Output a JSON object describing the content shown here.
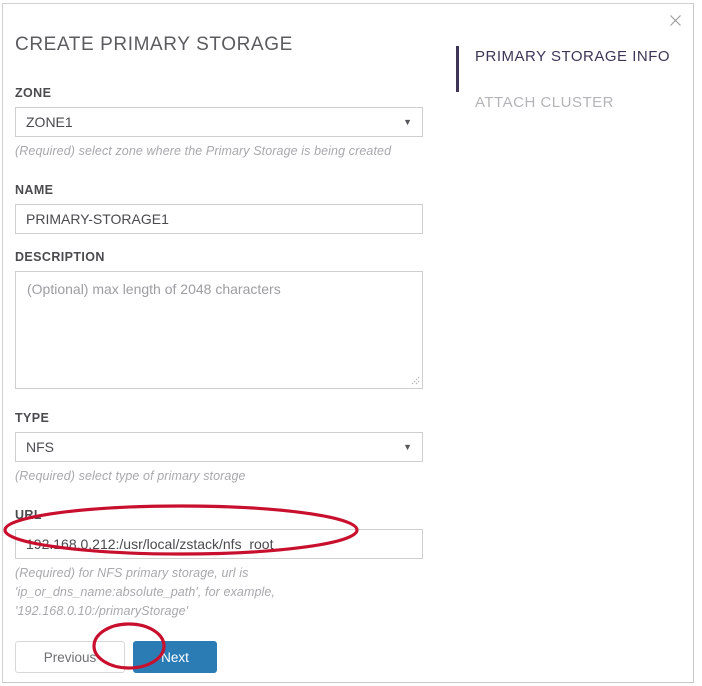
{
  "dialog": {
    "title": "CREATE PRIMARY STORAGE",
    "close_label": "×",
    "close_icon": "close-icon"
  },
  "form": {
    "zone": {
      "label": "ZONE",
      "value": "ZONE1",
      "caret": "▼",
      "hint": "(Required) select zone where the Primary Storage is being created"
    },
    "name": {
      "label": "NAME",
      "value": "PRIMARY-STORAGE1",
      "placeholder": ""
    },
    "description": {
      "label": "DESCRIPTION",
      "value": "",
      "placeholder": "(Optional) max length of 2048 characters"
    },
    "type": {
      "label": "TYPE",
      "value": "NFS",
      "caret": "▼",
      "hint": "(Required) select type of primary storage"
    },
    "url": {
      "label": "URL",
      "value": "192.168.0.212:/usr/local/zstack/nfs_root",
      "placeholder": "",
      "hint_line1": "(Required) for NFS primary storage, url is",
      "hint_line2": "'ip_or_dns_name:absolute_path', for example,",
      "hint_line3": "'192.168.0.10:/primaryStorage'"
    }
  },
  "buttons": {
    "previous_label": "Previous",
    "next_label": "Next"
  },
  "steps": {
    "items": [
      {
        "label": "PRIMARY STORAGE INFO",
        "active": true
      },
      {
        "label": "ATTACH CLUSTER",
        "active": false
      }
    ]
  },
  "colors": {
    "accent_step": "#3e3556",
    "primary_button": "#2b7cb5",
    "annotation_red": "#c8102e",
    "hint_text": "#a8a8ad"
  }
}
